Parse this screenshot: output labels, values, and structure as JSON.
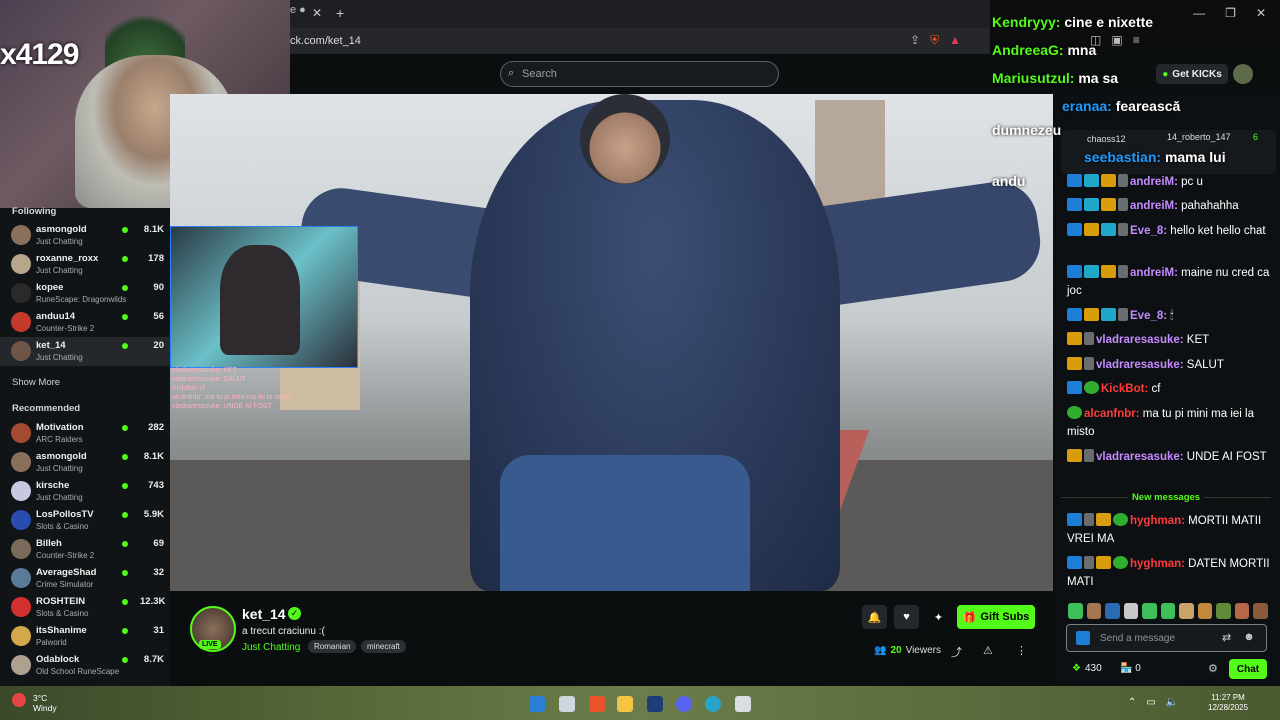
{
  "browser": {
    "tab_label": "e ●",
    "url": "ck.com/ket_14",
    "new_tab": "+"
  },
  "header": {
    "search_placeholder": "Search",
    "get_kicks_label": "Get KICKs"
  },
  "webcam": {
    "overlay_text": "x4129"
  },
  "sidebar": {
    "following_title": "Following",
    "following": [
      {
        "name": "asmongold",
        "category": "Just Chatting",
        "viewers": "8.1K",
        "color": "#8a6f5a"
      },
      {
        "name": "roxanne_roxx",
        "category": "Just Chatting",
        "viewers": "178",
        "color": "#b9a48e"
      },
      {
        "name": "kopee",
        "category": "RuneScape: Dragonwilds",
        "viewers": "90",
        "color": "#2a2a2a"
      },
      {
        "name": "anduu14",
        "category": "Counter-Strike 2",
        "viewers": "56",
        "color": "#c43a2a"
      },
      {
        "name": "ket_14",
        "category": "Just Chatting",
        "viewers": "20",
        "color": "#6d5548"
      }
    ],
    "show_more": "Show More",
    "recommended_title": "Recommended",
    "recommended": [
      {
        "name": "Motivation",
        "category": "ARC Raiders",
        "viewers": "282",
        "color": "#a34a32"
      },
      {
        "name": "asmongold",
        "category": "Just Chatting",
        "viewers": "8.1K",
        "color": "#8a6f5a"
      },
      {
        "name": "kirsche",
        "category": "Just Chatting",
        "viewers": "743",
        "color": "#c8c8e0"
      },
      {
        "name": "LosPollosTV",
        "category": "Slots & Casino",
        "viewers": "5.9K",
        "color": "#2a4bb0"
      },
      {
        "name": "Billeh",
        "category": "Counter-Strike 2",
        "viewers": "69",
        "color": "#7a6a5a"
      },
      {
        "name": "AverageShad",
        "category": "Crime Simulator",
        "viewers": "32",
        "color": "#5a7a9a"
      },
      {
        "name": "ROSHTEIN",
        "category": "Slots & Casino",
        "viewers": "12.3K",
        "color": "#d43030"
      },
      {
        "name": "itsShanime",
        "category": "Palworld",
        "viewers": "31",
        "color": "#d4a84a"
      },
      {
        "name": "Odablock",
        "category": "Old School RuneScape",
        "viewers": "8.7K",
        "color": "#b0a090"
      }
    ]
  },
  "pip": {
    "chat_lines": [
      "vladraresasuke: KET",
      "vladraresasuke: SALUT",
      "KickBot: cf",
      "alcanfnbr: ma tu pi mini ma lei la misto",
      "vladraresasuke: UNDE AI FOST"
    ]
  },
  "channel": {
    "name": "ket_14",
    "live": "LIVE",
    "title": "a trecut craciunu :(",
    "category": "Just Chatting",
    "tags": [
      "Romanian",
      "minecraft"
    ],
    "gift_label": "Gift Subs",
    "viewers_count": "20",
    "viewers_label": "Viewers"
  },
  "overlay_chat": [
    {
      "user": "Kendryyy:",
      "text": "cine e nixette",
      "color": "#53fc18"
    },
    {
      "user": "AndreeaG:",
      "text": "mna",
      "color": "#53fc18"
    },
    {
      "user": "Mariusutzul:",
      "text": "ma sa",
      "color": "#53fc18"
    },
    {
      "user": "eranaa:",
      "text": "fearească",
      "color": "#1f9bff"
    },
    {
      "user": "",
      "text": "dumnezeu",
      "color": "#ffffff"
    },
    {
      "user": "seebastian:",
      "text": "mama lui",
      "color": "#1f9bff"
    },
    {
      "user": "",
      "text": "andu",
      "color": "#ffffff"
    }
  ],
  "chat": {
    "pinned_user1": "chaoss12",
    "pinned_user2": "14_roberto_147",
    "pinned_count": "6",
    "messages": [
      {
        "user": "andreiM:",
        "text": "pc u",
        "color": "#c58bff"
      },
      {
        "user": "andreiM:",
        "text": "pahahahha",
        "color": "#c58bff"
      },
      {
        "user": "Eve_8:",
        "text": "hello ket hello chat",
        "color": "#c58bff"
      },
      {
        "user": "andreiM:",
        "text": "maine nu cred ca joc",
        "color": "#c58bff"
      },
      {
        "user": "Eve_8:",
        "text": "🕯",
        "color": "#c58bff"
      },
      {
        "user": "vladraresasuke:",
        "text": "KET",
        "color": "#c58bff"
      },
      {
        "user": "vladraresasuke:",
        "text": "SALUT",
        "color": "#c58bff"
      },
      {
        "user": "KickBot:",
        "text": "cf",
        "color": "#ff3b3b"
      },
      {
        "user": "alcanfnbr:",
        "text": "ma tu pi mini ma iei la misto",
        "color": "#ff3b3b"
      },
      {
        "user": "vladraresasuke:",
        "text": "UNDE AI FOST",
        "color": "#c58bff"
      }
    ],
    "new_messages_label": "New messages",
    "new_messages": [
      {
        "user": "hyghman:",
        "text": "MORTII MATII VREI MA",
        "color": "#ff3b3b"
      },
      {
        "user": "hyghman:",
        "text": "DATEN MORTII MATI",
        "color": "#ff3b3b"
      }
    ],
    "input_placeholder": "Send a message",
    "points": "430",
    "zero": "0",
    "chat_button": "Chat"
  },
  "taskbar": {
    "temp": "3°C",
    "weather": "Windy",
    "time": "11:27 PM",
    "date": "12/28/2025"
  }
}
